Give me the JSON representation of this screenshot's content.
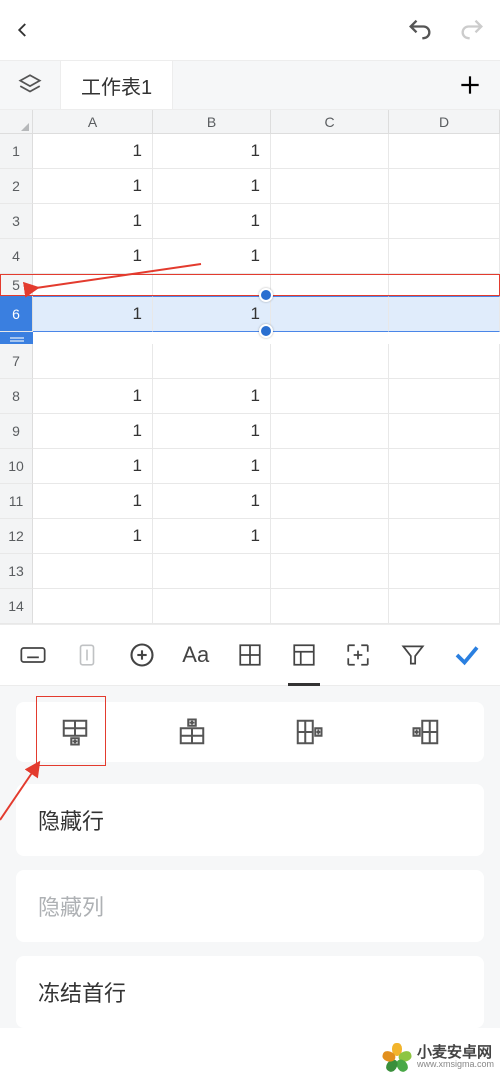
{
  "sheet_tab": "工作表1",
  "columns": [
    "A",
    "B",
    "C",
    "D"
  ],
  "rows": [
    {
      "hdr": "1",
      "cells": [
        "1",
        "1",
        "",
        ""
      ]
    },
    {
      "hdr": "2",
      "cells": [
        "1",
        "1",
        "",
        ""
      ]
    },
    {
      "hdr": "3",
      "cells": [
        "1",
        "1",
        "",
        ""
      ]
    },
    {
      "hdr": "4",
      "cells": [
        "1",
        "1",
        "",
        ""
      ]
    },
    {
      "hdr": "5",
      "cells": [
        "",
        "",
        "",
        ""
      ]
    },
    {
      "hdr": "6",
      "cells": [
        "1",
        "1",
        "",
        ""
      ]
    },
    {
      "hdr": "7",
      "cells": [
        "",
        "",
        "",
        ""
      ]
    },
    {
      "hdr": "8",
      "cells": [
        "1",
        "1",
        "",
        ""
      ]
    },
    {
      "hdr": "9",
      "cells": [
        "1",
        "1",
        "",
        ""
      ]
    },
    {
      "hdr": "10",
      "cells": [
        "1",
        "1",
        "",
        ""
      ]
    },
    {
      "hdr": "11",
      "cells": [
        "1",
        "1",
        "",
        ""
      ]
    },
    {
      "hdr": "12",
      "cells": [
        "1",
        "1",
        "",
        ""
      ]
    },
    {
      "hdr": "13",
      "cells": [
        "",
        "",
        "",
        ""
      ]
    },
    {
      "hdr": "14",
      "cells": [
        "",
        "",
        "",
        ""
      ]
    }
  ],
  "options": {
    "hide_row": "隐藏行",
    "hide_col": "隐藏列",
    "freeze_first_row": "冻结首行"
  },
  "watermark": {
    "name": "小麦安卓网",
    "url": "www.xmsigma.com"
  }
}
